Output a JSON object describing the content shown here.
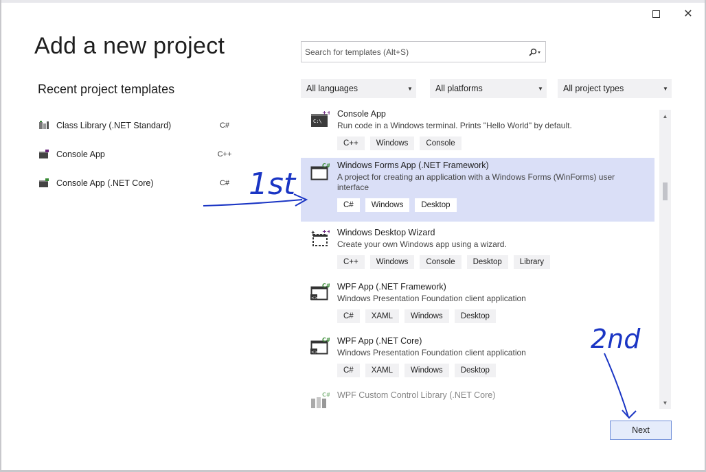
{
  "window": {
    "maximize_icon": "maximize-icon",
    "close_glyph": "✕"
  },
  "page": {
    "title": "Add a new project"
  },
  "recent": {
    "title": "Recent project templates",
    "items": [
      {
        "label": "Class Library (.NET Standard)",
        "lang": "C#",
        "icon": "class-library-icon"
      },
      {
        "label": "Console App",
        "lang": "C++",
        "icon": "console-app-icon"
      },
      {
        "label": "Console App (.NET Core)",
        "lang": "C#",
        "icon": "console-app-icon"
      }
    ]
  },
  "search": {
    "placeholder": "Search for templates (Alt+S)",
    "value": ""
  },
  "filters": {
    "language": "All languages",
    "platform": "All platforms",
    "project_type": "All project types"
  },
  "templates": [
    {
      "name": "Console App",
      "desc": "Run code in a Windows terminal. Prints \"Hello World\" by default.",
      "tags": [
        "C++",
        "Windows",
        "Console"
      ],
      "badge": "++",
      "selected": false
    },
    {
      "name": "Windows Forms App (.NET Framework)",
      "desc": "A project for creating an application with a Windows Forms (WinForms) user interface",
      "tags": [
        "C#",
        "Windows",
        "Desktop"
      ],
      "badge": "C#",
      "selected": true
    },
    {
      "name": "Windows Desktop Wizard",
      "desc": "Create your own Windows app using a wizard.",
      "tags": [
        "C++",
        "Windows",
        "Console",
        "Desktop",
        "Library"
      ],
      "badge": "++",
      "selected": false
    },
    {
      "name": "WPF App (.NET Framework)",
      "desc": "Windows Presentation Foundation client application",
      "tags": [
        "C#",
        "XAML",
        "Windows",
        "Desktop"
      ],
      "badge": "C#",
      "selected": false
    },
    {
      "name": "WPF App (.NET Core)",
      "desc": "Windows Presentation Foundation client application",
      "tags": [
        "C#",
        "XAML",
        "Windows",
        "Desktop"
      ],
      "badge": "C#",
      "selected": false
    },
    {
      "name": "WPF Custom Control Library (.NET Core)",
      "desc": "",
      "tags": [],
      "badge": "C#",
      "selected": false
    }
  ],
  "footer": {
    "next_label": "Next"
  },
  "annotations": {
    "first": "1st",
    "second": "2nd",
    "color": "#1a35c4"
  },
  "colors": {
    "selected_row": "#dadff7",
    "csharp_badge": "#388a34",
    "cpp_badge": "#68217a"
  }
}
